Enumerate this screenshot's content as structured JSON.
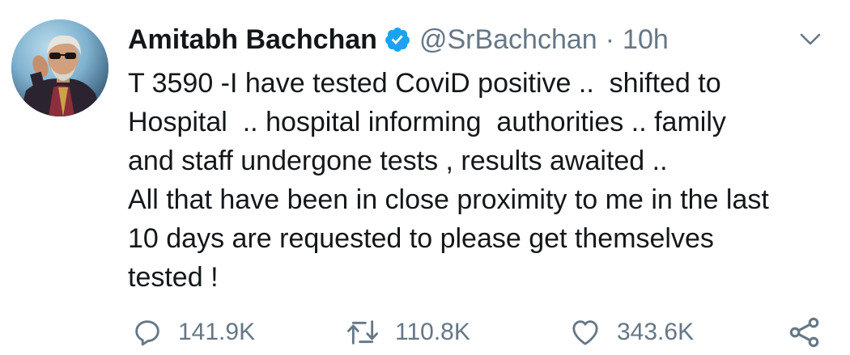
{
  "tweet": {
    "author_name": "Amitabh Bachchan",
    "handle": "@SrBachchan",
    "separator": "·",
    "time": "10h",
    "text_lines": [
      "T 3590 -I have tested CoviD positive ..  shifted to",
      "Hospital  .. hospital informing  authorities .. family",
      "and staff undergone tests , results awaited ..",
      "All that have been in close proximity to me in the last",
      "10 days are requested to please get themselves",
      "tested !"
    ],
    "replies": "141.9K",
    "retweets": "110.8K",
    "likes": "343.6K"
  },
  "icons": {
    "verified": "verified-badge-icon",
    "caret": "chevron-down-icon",
    "reply": "reply-icon",
    "retweet": "retweet-icon",
    "like": "heart-icon",
    "share": "share-icon"
  },
  "colors": {
    "verified_blue": "#1da1f2",
    "text_primary": "#14171a",
    "text_secondary": "#657786"
  }
}
